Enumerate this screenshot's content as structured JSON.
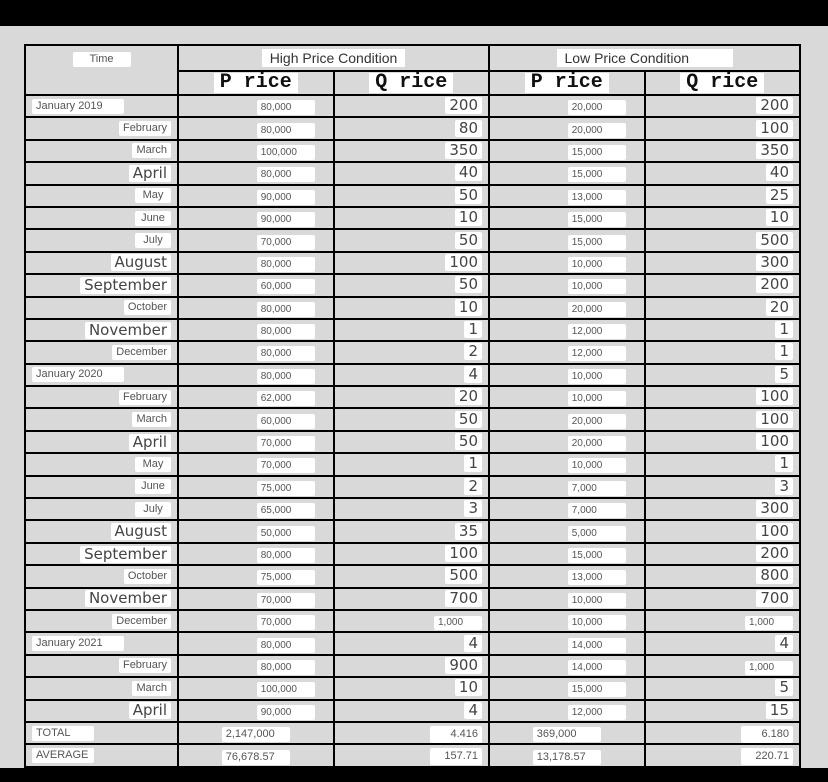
{
  "header": {
    "time_label": "Time",
    "high_condition": "High Price Condition",
    "low_condition": "Low Price Condition",
    "high_p": "P rice",
    "high_q": "Q rice",
    "low_p": "P rice",
    "low_q": "Q rice"
  },
  "rows": [
    {
      "time": "January 2019",
      "hp": "80,000",
      "hq": "200",
      "lp": "20,000",
      "lq": "200"
    },
    {
      "time": "February",
      "hp": "80,000",
      "hq": "80",
      "lp": "20,000",
      "lq": "100"
    },
    {
      "time": "March",
      "hp": "100,000",
      "hq": "350",
      "lp": "15,000",
      "lq": "350"
    },
    {
      "time": "April",
      "hp": "80,000",
      "hq": "40",
      "lp": "15,000",
      "lq": "40"
    },
    {
      "time": "May",
      "hp": "90,000",
      "hq": "50",
      "lp": "13,000",
      "lq": "25"
    },
    {
      "time": "June",
      "hp": "90,000",
      "hq": "10",
      "lp": "15,000",
      "lq": "10"
    },
    {
      "time": "July",
      "hp": "70,000",
      "hq": "50",
      "lp": "15,000",
      "lq": "500"
    },
    {
      "time": "August",
      "hp": "80,000",
      "hq": "100",
      "lp": "10,000",
      "lq": "300"
    },
    {
      "time": "September",
      "hp": "60,000",
      "hq": "50",
      "lp": "10,000",
      "lq": "200"
    },
    {
      "time": "October",
      "hp": "80,000",
      "hq": "10",
      "lp": "20,000",
      "lq": "20"
    },
    {
      "time": "November",
      "hp": "80,000",
      "hq": "1",
      "lp": "12,000",
      "lq": "1"
    },
    {
      "time": "December",
      "hp": "80,000",
      "hq": "2",
      "lp": "12,000",
      "lq": "1"
    },
    {
      "time": "January 2020",
      "hp": "80,000",
      "hq": "4",
      "lp": "10,000",
      "lq": "5"
    },
    {
      "time": "February",
      "hp": "62,000",
      "hq": "20",
      "lp": "10,000",
      "lq": "100"
    },
    {
      "time": "March",
      "hp": "60,000",
      "hq": "50",
      "lp": "20,000",
      "lq": "100"
    },
    {
      "time": "April",
      "hp": "70,000",
      "hq": "50",
      "lp": "20,000",
      "lq": "100"
    },
    {
      "time": "May",
      "hp": "70,000",
      "hq": "1",
      "lp": "10,000",
      "lq": "1"
    },
    {
      "time": "June",
      "hp": "75,000",
      "hq": "2",
      "lp": "7,000",
      "lq": "3"
    },
    {
      "time": "July",
      "hp": "65,000",
      "hq": "3",
      "lp": "7,000",
      "lq": "300"
    },
    {
      "time": "August",
      "hp": "50,000",
      "hq": "35",
      "lp": "5,000",
      "lq": "100"
    },
    {
      "time": "September",
      "hp": "80,000",
      "hq": "100",
      "lp": "15,000",
      "lq": "200"
    },
    {
      "time": "October",
      "hp": "75,000",
      "hq": "500",
      "lp": "13,000",
      "lq": "800"
    },
    {
      "time": "November",
      "hp": "70,000",
      "hq": "700",
      "lp": "10,000",
      "lq": "700"
    },
    {
      "time": "December",
      "hp": "70,000",
      "hq": "1,000",
      "lp": "10,000",
      "lq": "1,000"
    },
    {
      "time": "January 2021",
      "hp": "80,000",
      "hq": "4",
      "lp": "14,000",
      "lq": "4"
    },
    {
      "time": "February",
      "hp": "80,000",
      "hq": "900",
      "lp": "14,000",
      "lq": "1,000"
    },
    {
      "time": "March",
      "hp": "100,000",
      "hq": "10",
      "lp": "15,000",
      "lq": "5"
    },
    {
      "time": "April",
      "hp": "90,000",
      "hq": "4",
      "lp": "12,000",
      "lq": "15"
    }
  ],
  "total": {
    "label": "TOTAL",
    "hp": "2,147,000",
    "hq": "4.416",
    "lp": "369,000",
    "lq": "6.180"
  },
  "average": {
    "label": "AVERAGE",
    "hp": "76,678.57",
    "hq": "157.71",
    "lp": "13,178.57",
    "lq": "220.71"
  }
}
